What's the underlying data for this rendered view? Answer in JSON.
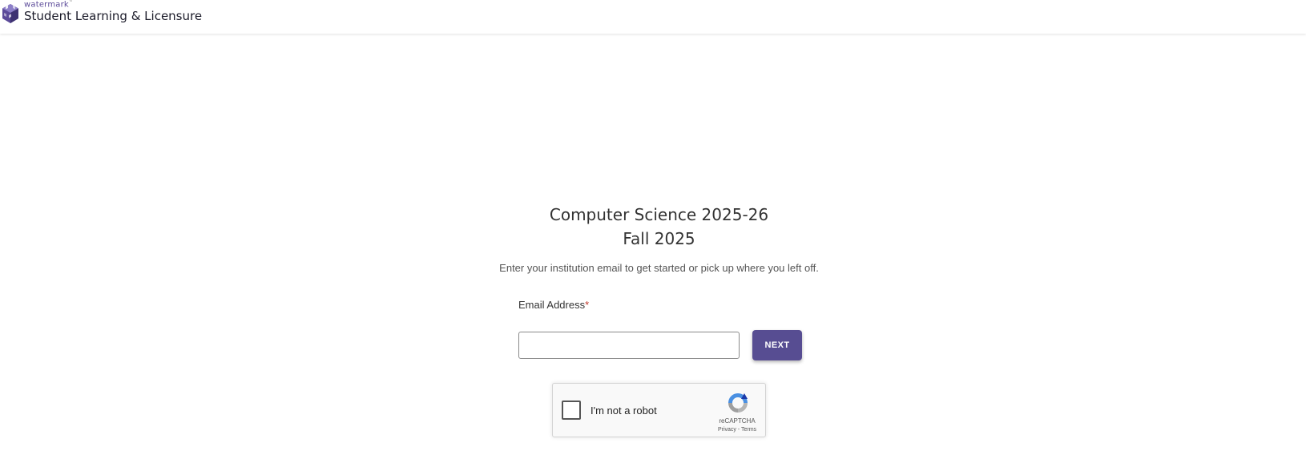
{
  "header": {
    "brand_small": "watermark",
    "brand_tm": "™",
    "brand_name": "Student Learning & Licensure",
    "logo_icon": "watermark-cube-logo",
    "brand_color": "#5b4a99"
  },
  "main": {
    "title_line1": "Computer Science 2025-26",
    "title_line2": "Fall 2025",
    "subtitle": "Enter your institution email to get started or pick up where you left off.",
    "email_label": "Email Address",
    "required_marker": "*",
    "email_value": "",
    "next_label": "NEXT",
    "button_color": "#574d92"
  },
  "recaptcha": {
    "label": "I'm not a robot",
    "brand": "reCAPTCHA",
    "privacy": "Privacy",
    "separator": " - ",
    "terms": "Terms",
    "icon": "recaptcha-icon"
  }
}
